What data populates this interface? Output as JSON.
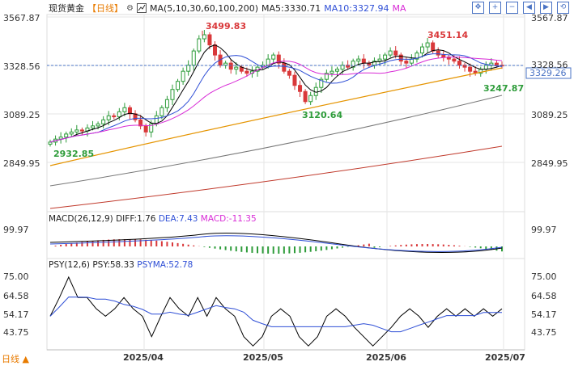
{
  "header": {
    "symbol": "现货黄金",
    "period": "【日线】",
    "indicator_icon": "settings-icon",
    "ma_label": "MA(5,10,30,60,100,200)",
    "ma5": "MA5:3330.71",
    "ma10": "MA10:3327.94",
    "ma_extra": "MA"
  },
  "toolbar": {
    "icons": [
      "move-icon",
      "zoom-in-icon",
      "zoom-out-icon",
      "pan-left-icon",
      "pan-right-icon",
      "reset-icon"
    ]
  },
  "main_axis": {
    "left_ticks": [
      "3567.87",
      "3328.56",
      "3089.25",
      "2849.95"
    ],
    "right_ticks": [
      "3567.87",
      "3328.56",
      "3089.25",
      "2849.95"
    ],
    "current_price": "3329.26",
    "annotations": {
      "high1": "3499.83",
      "high2": "3451.14",
      "low1": "3120.64",
      "low2": "2932.85",
      "last_low": "3247.87"
    }
  },
  "macd": {
    "label": "MACD(26,12,9)",
    "diff": "DIFF:1.76",
    "dea": "DEA:7.43",
    "macd": "MACD:-11.35",
    "tick_left": "99.97",
    "tick_right": "99.97"
  },
  "psy": {
    "label": "PSY(12,6)",
    "psy": "PSY:58.33",
    "psyma": "PSYMA:52.78",
    "ticks_left": [
      "75.00",
      "64.58",
      "54.17",
      "43.75"
    ],
    "ticks_right": [
      "75.00",
      "64.58",
      "54.17",
      "43.75"
    ]
  },
  "time_axis": {
    "labels": [
      "2025/04",
      "2025/05",
      "2025/06",
      "2025/07"
    ]
  },
  "bottom": {
    "period_label": "日线 ▲"
  },
  "colors": {
    "up": "#2e9c3a",
    "down": "#d9383a",
    "ma5": "#000000",
    "ma10": "#2f4fd6",
    "ma_magenta": "#d82bd6",
    "ma_orange": "#e59400",
    "ma_gray": "#777777",
    "ma_red": "#c0392b",
    "grid": "#e6e6e6",
    "axis_text": "#333333",
    "price_tag": "#4a73c4"
  },
  "chart_data": {
    "type": "candlestick",
    "x": [
      "2025/04",
      "2025/05",
      "2025/06",
      "2025/07"
    ],
    "ylim": [
      2750,
      3620
    ],
    "annotated_prices": [
      3499.83,
      3451.14,
      3120.64,
      2932.85,
      3247.87
    ],
    "current": 3329.26,
    "macd": {
      "diff": 1.76,
      "dea": 7.43,
      "macd": -11.35
    },
    "psy": {
      "psy": 58.33,
      "psyma": 52.78,
      "ylim": [
        30,
        85
      ]
    }
  }
}
